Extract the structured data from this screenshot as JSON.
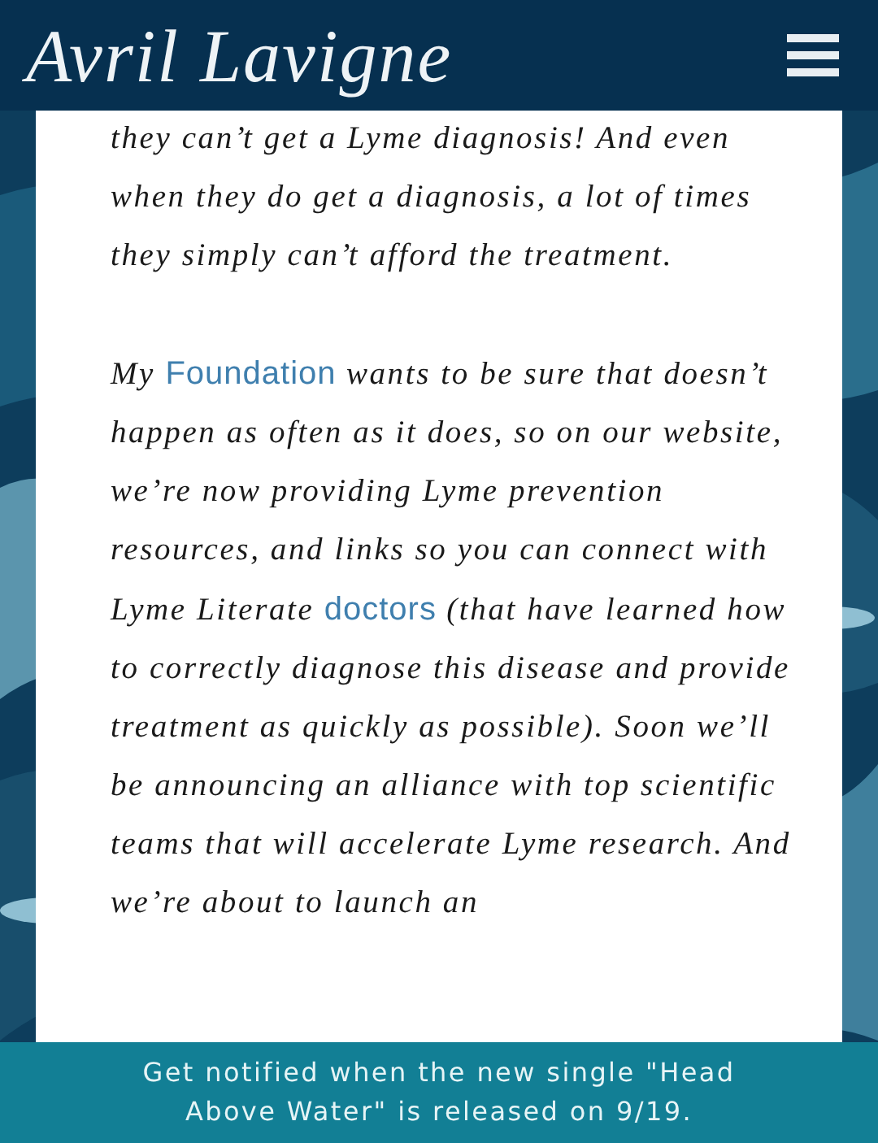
{
  "header": {
    "logo": "Avril Lavigne"
  },
  "article": {
    "paragraphs": [
      {
        "parts": [
          {
            "kind": "text",
            "text": "they can’t get a Lyme diagnosis! And even when they do get a diagnosis, a lot of times they simply can’t afford the treatment."
          }
        ]
      },
      {
        "parts": [
          {
            "kind": "text",
            "text": "My "
          },
          {
            "kind": "link",
            "text": "Foundation"
          },
          {
            "kind": "text",
            "text": " wants to be sure that doesn’t happen as often as it does, so on our website, we’re now providing Lyme prevention resources, and links so you can connect with Lyme Literate "
          },
          {
            "kind": "link",
            "text": "doctors"
          },
          {
            "kind": "text",
            "text": " (that have learned how to correctly diagnose this disease and provide treatment as quickly as possible). Soon we’ll be announcing an alliance with top scientific teams that will accelerate Lyme research. And we’re about to launch an"
          }
        ]
      }
    ]
  },
  "banner": {
    "text": "Get notified when the new single \"Head Above Water\" is released on 9/19."
  }
}
